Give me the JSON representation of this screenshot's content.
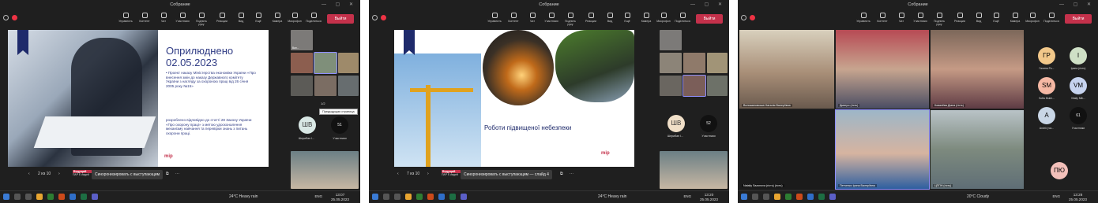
{
  "window_title": "Собрание",
  "toolbar": {
    "labels": [
      "Управлять",
      "Контент",
      "Чат",
      "Участники",
      "Поднять руку",
      "Реакции",
      "Вид",
      "Ещё",
      "Камера",
      "Микрофон",
      "Поделиться"
    ],
    "leave": "Выйти"
  },
  "shot1": {
    "slide_title_1": "Оприлюднено",
    "slide_title_2": "02.05.2023",
    "slide_bullet": "• Проект наказу Міністерства економіки України «Про внесення змін до наказу Державного комітету України з нагляду за охороною праці від 26 січня 2005 року №15»",
    "slide_note": "розроблено відповідно до статті 28 Закону України «Про охорону праці» з метою удосконалення механізму навчання та перевірки знань з питань охорони праці.",
    "logo_text": "mip",
    "pager": "2 из 10",
    "sync": "Синхронизировать с выступающим",
    "presenter_badge": "Ведущий",
    "presenter_name": "ПАР Е.Авдей",
    "tooltip": "Предыдущая страница",
    "tile_names": [
      "Вал...",
      "",
      "",
      "",
      "",
      "",
      "",
      ""
    ],
    "avatar_initials": "ШВ",
    "avatar_label": "Шерибан І...",
    "count": "51",
    "count_label": "Участники",
    "page_indicator": "1/2"
  },
  "shot2": {
    "slide_title": "Роботи підвищеної небезпеки",
    "logo_text": "mip",
    "pager": "7 из 10",
    "sync": "Синхронизировать с выступающим — слайд 4",
    "presenter_badge": "Ведущий",
    "presenter_name": "ПАР Е.Авдей",
    "avatar_initials": "ШВ",
    "avatar_label": "Шерибан І...",
    "count": "52",
    "count_label": "Участники"
  },
  "shot3": {
    "grid": [
      {
        "name": "Волошиновська Наталія Валеріївна"
      },
      {
        "name": "Дмитро (гість)"
      },
      {
        "name": "Ковалёва Діана (гість)"
      },
      {
        "name": "Nataliy Sazonova (гість) (гість)"
      },
      {
        "name": "Петченко Ірина Валеріївна"
      },
      {
        "name": "ЦППН (гість)"
      }
    ],
    "side": [
      {
        "initials": "ГР",
        "label": "Галина Ро..."
      },
      {
        "initials": "І",
        "label": "Ірина (гість)"
      },
      {
        "initials": "SM",
        "label": "Sofia Mukh..."
      },
      {
        "initials": "VM",
        "label": "Vitaliy Mih..."
      },
      {
        "initials": "А",
        "label": "Andrii (гос..."
      },
      {
        "initials": "61",
        "label": "Участники"
      },
      {
        "initials": "ПЮ",
        "label": ""
      }
    ]
  },
  "taskbar": {
    "weather_1": "24°C  Heavy rain",
    "weather_2": "24°C  Heavy rain",
    "weather_3": "20°C  Cloudy",
    "lang": "ENG",
    "time_1": "13:07",
    "time_2": "13:20",
    "time_3": "13:28",
    "date": "25.05.2023"
  },
  "colors": {
    "accent": "#c4314b",
    "navy": "#2f3b84",
    "dark": "#1f1f1f"
  }
}
